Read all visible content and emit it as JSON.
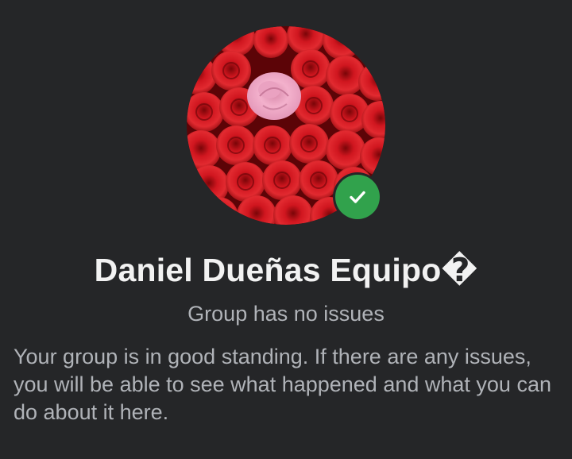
{
  "group": {
    "name": "Daniel Dueñas Equipo�",
    "status": "Group has no issues",
    "description": "Your group is in good standing. If there are any issues, you will be able to see what happened and what you can do about it here."
  },
  "avatar": {
    "icon": "roses-photo",
    "colors": {
      "rose_red": "#c4121a",
      "rose_pink": "#f2a7c6"
    }
  },
  "badge": {
    "icon": "check-icon",
    "color": "#31a24c"
  },
  "theme": {
    "background": "#252628",
    "title_color": "#f2f2f2",
    "secondary_text": "#b0b3b8"
  }
}
